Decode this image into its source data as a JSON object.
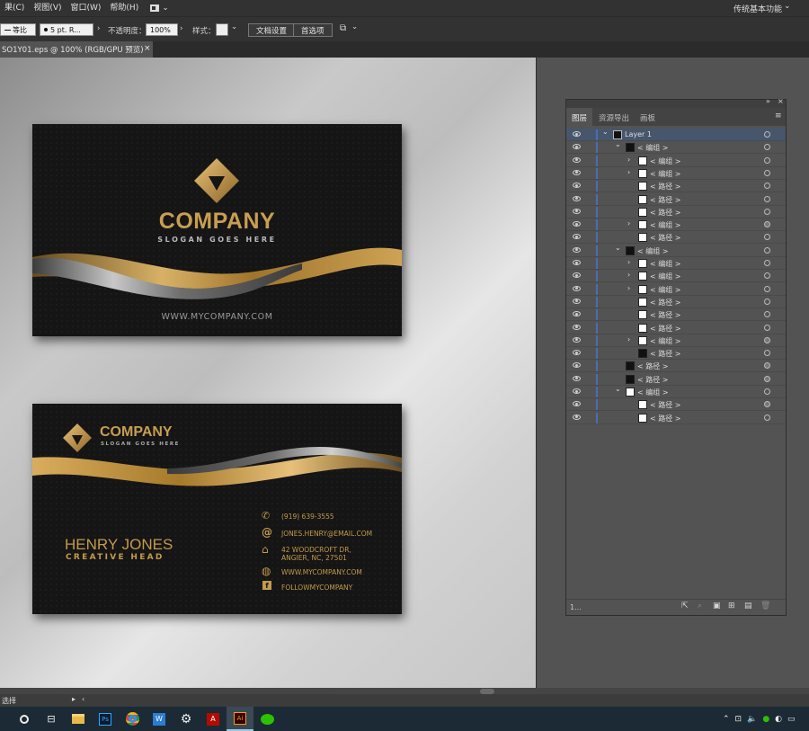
{
  "menubar": {
    "items": [
      "果(C)",
      "视图(V)",
      "窗口(W)",
      "帮助(H)"
    ],
    "workspace": "传统基本功能"
  },
  "control_bar": {
    "stroke_style": "等比",
    "stroke_weight": "5 pt. R...",
    "opacity_label": "不透明度：",
    "opacity_value": "100%",
    "style_label": "样式：",
    "doc_setup_btn": "文档设置",
    "prefs_btn": "首选项"
  },
  "doc_tab": {
    "title": "SO1Y01.eps @ 100% (RGB/GPU 预览)"
  },
  "front_card": {
    "company": "COMPANY",
    "slogan": "SLOGAN GOES HERE",
    "website": "WWW.MYCOMPANY.COM"
  },
  "back_card": {
    "company": "COMPANY",
    "slogan": "SLOGAN GOES HERE",
    "name": "HENRY JONES",
    "title": "CREATIVE HEAD",
    "phone": "(919) 639-3555",
    "email": "JONES.HENRY@EMAIL.COM",
    "address_1": "42 WOODCROFT DR,",
    "address_2": "ANGIER, NC, 27501",
    "website": "WWW.MYCOMPANY.COM",
    "social": "FOLLOWMYCOMPANY"
  },
  "layers_panel": {
    "tabs": [
      "图层",
      "资源导出",
      "画板"
    ],
    "footer_count": "1...",
    "rows": [
      {
        "name": "Layer 1",
        "expanded": true,
        "selected": true
      },
      {
        "name": "< 编组 >",
        "expanded": true
      },
      {
        "name": "< 编组 >"
      },
      {
        "name": "< 编组 >"
      },
      {
        "name": "< 路径 >"
      },
      {
        "name": "< 路径 >"
      },
      {
        "name": "< 路径 >"
      },
      {
        "name": "< 编组 >"
      },
      {
        "name": "< 路径 >"
      },
      {
        "name": "< 编组 >",
        "expanded": true
      },
      {
        "name": "< 编组 >"
      },
      {
        "name": "< 编组 >"
      },
      {
        "name": "< 编组 >"
      },
      {
        "name": "< 路径 >"
      },
      {
        "name": "< 路径 >"
      },
      {
        "name": "< 路径 >"
      },
      {
        "name": "< 编组 >"
      },
      {
        "name": "< 路径 >"
      },
      {
        "name": "< 路径 >"
      },
      {
        "name": "< 路径 >"
      },
      {
        "name": "< 编组 >",
        "expanded": true
      },
      {
        "name": "< 路径 >"
      },
      {
        "name": "< 路径 >"
      }
    ]
  },
  "statusbar": {
    "tool": "选择"
  },
  "colors": {
    "gold": "#c49a4c",
    "ui_dark": "#323232",
    "panel": "#535353"
  }
}
